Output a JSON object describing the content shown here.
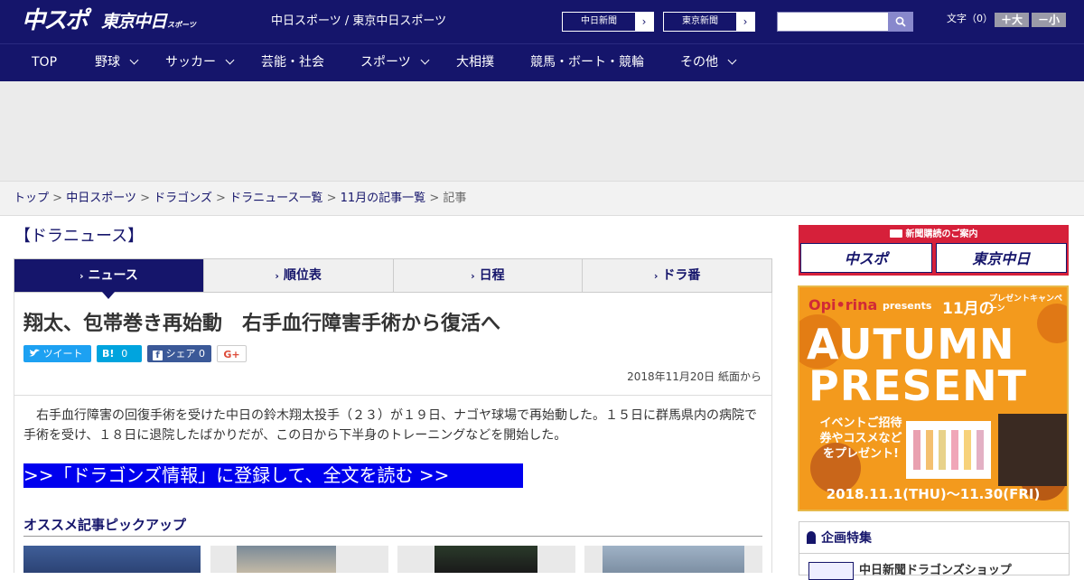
{
  "header": {
    "logo_main": "中スポ",
    "logo_tokyo": "東京中日",
    "logo_tokyo_small": "スポーツ",
    "site_subtitle": "中日スポーツ / 東京中日スポーツ",
    "link_chunichi": "中日新聞",
    "link_tokyo": "東京新聞",
    "search_placeholder": "",
    "font_size_label": "文字（0）",
    "font_larger": "＋大",
    "font_smaller": "－小"
  },
  "nav": {
    "items": [
      {
        "label": "TOP"
      },
      {
        "label": "野球"
      },
      {
        "label": "サッカー"
      },
      {
        "label": "芸能・社会"
      },
      {
        "label": "スポーツ"
      },
      {
        "label": "大相撲"
      },
      {
        "label": "競馬・ボート・競輪"
      },
      {
        "label": "その他"
      }
    ]
  },
  "breadcrumb": {
    "items": [
      "トップ",
      "中日スポーツ",
      "ドラゴンズ",
      "ドラニュース一覧",
      "11月の記事一覧"
    ],
    "current": "記事",
    "separator": ">"
  },
  "section": {
    "heading": "【ドラニュース】"
  },
  "tabs": [
    {
      "label": "ニュース",
      "active": true
    },
    {
      "label": "順位表",
      "active": false
    },
    {
      "label": "日程",
      "active": false
    },
    {
      "label": "ドラ番",
      "active": false
    }
  ],
  "article": {
    "title": "翔太、包帯巻き再始動　右手血行障害手術から復活へ",
    "share": {
      "tweet": "ツイート",
      "hatena": "B!",
      "hatena_count": "0",
      "facebook": "シェア",
      "facebook_count": "0",
      "gplus": "G+"
    },
    "date": "2018年11月20日 紙面から",
    "body": "　右手血行障害の回復手術を受けた中日の鈴木翔太投手（２３）が１９日、ナゴヤ球場で再始動した。１５日に群馬県内の病院で手術を受け、１８日に退院したばかりだが、この日から下半身のトレーニングなどを開始した。",
    "cta": ">>「ドラゴンズ情報」に登録して、全文を読む >>"
  },
  "pickup": {
    "title": "オススメ記事ピックアップ"
  },
  "sidebar": {
    "subscribe_caption": "新聞購読のご案内",
    "subscribe_logo1": "中スポ",
    "subscribe_logo2": "東京中日",
    "promo": {
      "brand": "Opi•rina",
      "presents": "presents",
      "month": "11月の",
      "campaign": "プレゼントキャンペーン",
      "headline1": "AUTUMN",
      "headline2": "PRESENT",
      "event_text": "イベントご招待券やコスメなどをプレゼント!",
      "dates": "2018.11.1(THU)～11.30(FRI)"
    },
    "feature_title": "企画特集",
    "feature_item": "中日新聞ドラゴンズショップ"
  },
  "colors": {
    "brand": "#15156b",
    "cta": "#0000ee",
    "accent_red": "#d6203a",
    "promo_orange": "#f59a1c"
  }
}
